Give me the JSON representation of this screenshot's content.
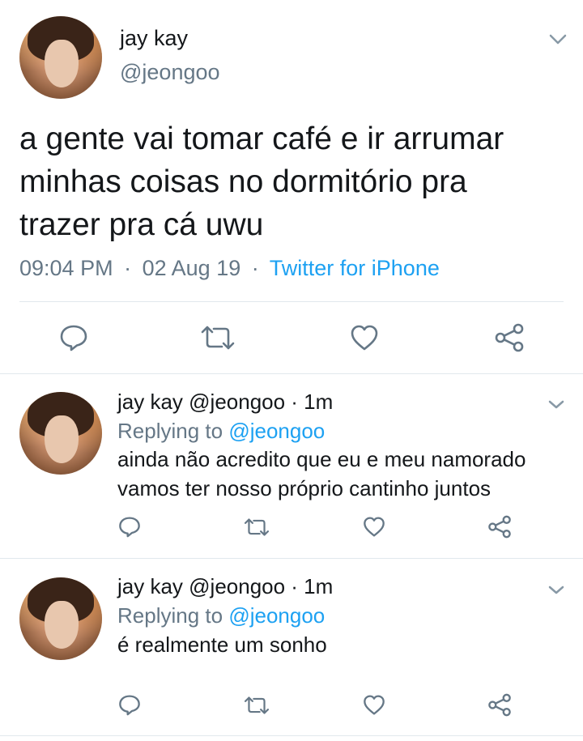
{
  "main_tweet": {
    "display_name": "jay kay",
    "handle": "@jeongoo",
    "text_lines": [
      "a gente vai tomar café e ir arrumar",
      "minhas coisas no dormitório pra",
      "trazer pra cá uwu"
    ],
    "time": "09:04 PM",
    "date": "02 Aug 19",
    "source": "Twitter for iPhone",
    "separator": "·"
  },
  "replies": [
    {
      "header": "jay kay @jeongoo · 1m",
      "replying_prefix": "Replying to ",
      "replying_handle": "@jeongoo",
      "text_lines": [
        "ainda não acredito que eu e meu namorado",
        "vamos ter nosso próprio cantinho juntos"
      ]
    },
    {
      "header": "jay kay @jeongoo · 1m",
      "replying_prefix": "Replying to ",
      "replying_handle": "@jeongoo",
      "text_lines": [
        "é realmente um sonho"
      ]
    }
  ],
  "icons": {
    "reply": "reply-icon",
    "retweet": "retweet-icon",
    "like": "like-icon",
    "share": "share-icon",
    "chevron": "chevron-down-icon"
  },
  "colors": {
    "text": "#14171a",
    "muted": "#657786",
    "link": "#1da1f2",
    "divider": "#e1e8ed",
    "icon": "#657786"
  }
}
